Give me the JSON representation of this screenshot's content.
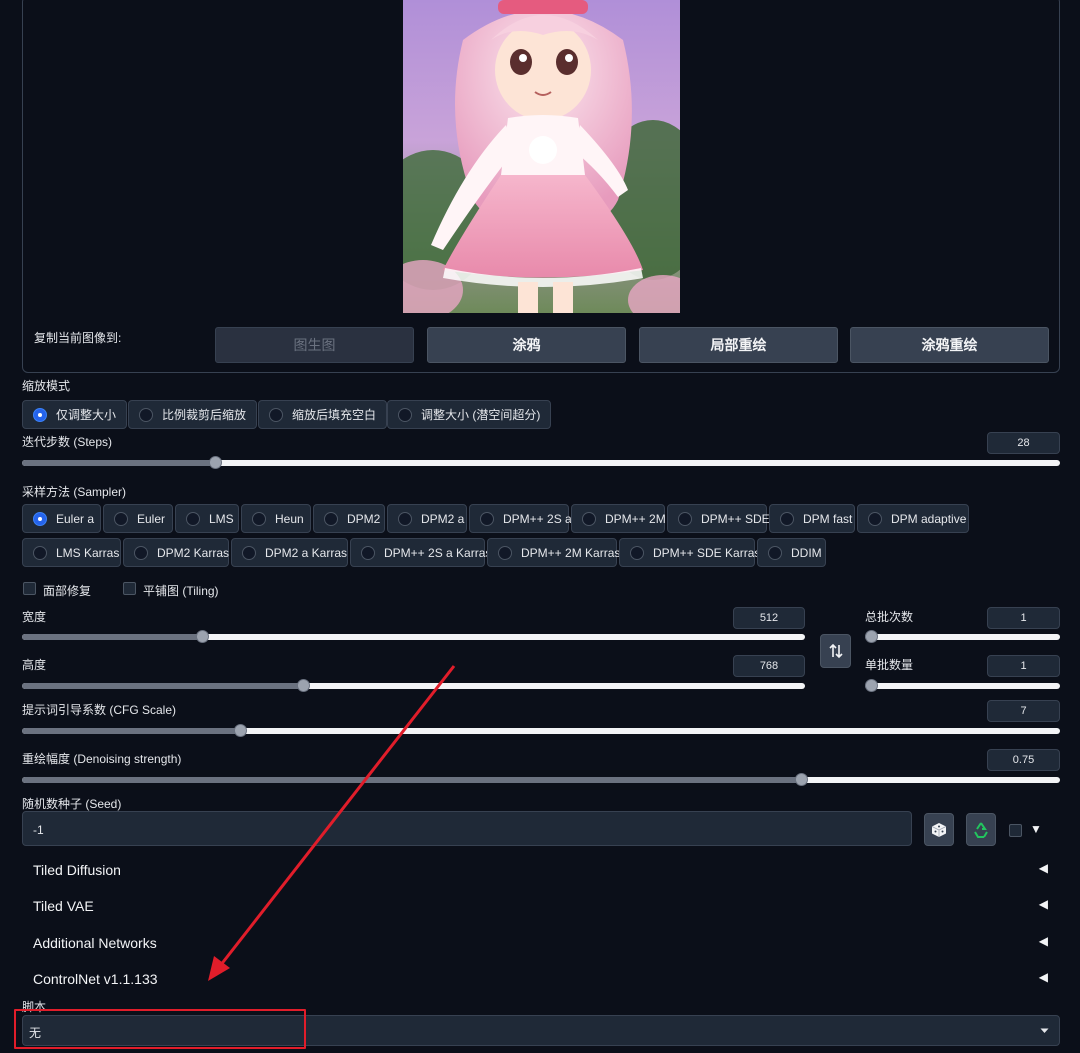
{
  "copy_panel": {
    "label": "复制当前图像到:",
    "buttons": [
      "图生图",
      "涂鸦",
      "局部重绘",
      "涂鸦重绘"
    ]
  },
  "resize_mode": {
    "label": "缩放模式",
    "options": [
      "仅调整大小",
      "比例裁剪后缩放",
      "缩放后填充空白",
      "调整大小 (潜空间超分)"
    ],
    "selected": 0
  },
  "steps": {
    "label": "迭代步数 (Steps)",
    "value": "28",
    "fraction": 0.186
  },
  "sampler": {
    "label": "采样方法 (Sampler)",
    "row1": [
      "Euler a",
      "Euler",
      "LMS",
      "Heun",
      "DPM2",
      "DPM2 a",
      "DPM++ 2S a",
      "DPM++ 2M",
      "DPM++ SDE",
      "DPM fast",
      "DPM adaptive"
    ],
    "row2": [
      "LMS Karras",
      "DPM2 Karras",
      "DPM2 a Karras",
      "DPM++ 2S a Karras",
      "DPM++ 2M Karras",
      "DPM++ SDE Karras",
      "DDIM"
    ],
    "selected": "Euler a"
  },
  "face_restore": {
    "label": "面部修复"
  },
  "tiling": {
    "label": "平铺图 (Tiling)"
  },
  "width": {
    "label": "宽度",
    "value": "512",
    "fraction": 0.23
  },
  "height": {
    "label": "高度",
    "value": "768",
    "fraction": 0.359
  },
  "batch_count": {
    "label": "总批次数",
    "value": "1",
    "fraction": 0.0
  },
  "batch_size": {
    "label": "单批数量",
    "value": "1",
    "fraction": 0.0
  },
  "cfg": {
    "label": "提示词引导系数 (CFG Scale)",
    "value": "7",
    "fraction": 0.21
  },
  "denoise": {
    "label": "重绘幅度 (Denoising strength)",
    "value": "0.75",
    "fraction": 0.75
  },
  "seed": {
    "label": "随机数种子 (Seed)",
    "value": "-1"
  },
  "accordions": [
    "Tiled Diffusion",
    "Tiled VAE",
    "Additional Networks",
    "ControlNet v1.1.133"
  ],
  "script": {
    "label": "脚本",
    "value": "无"
  },
  "icons": {
    "swap": "swap-arrows-icon",
    "dice": "dice-icon",
    "recycle": "recycle-icon",
    "collapse": "triangle-left-icon",
    "dropdown": "chevron-down-icon"
  },
  "colors": {
    "accent": "#2563eb",
    "annotation": "#e11d2a",
    "recycle": "#22c55e"
  }
}
